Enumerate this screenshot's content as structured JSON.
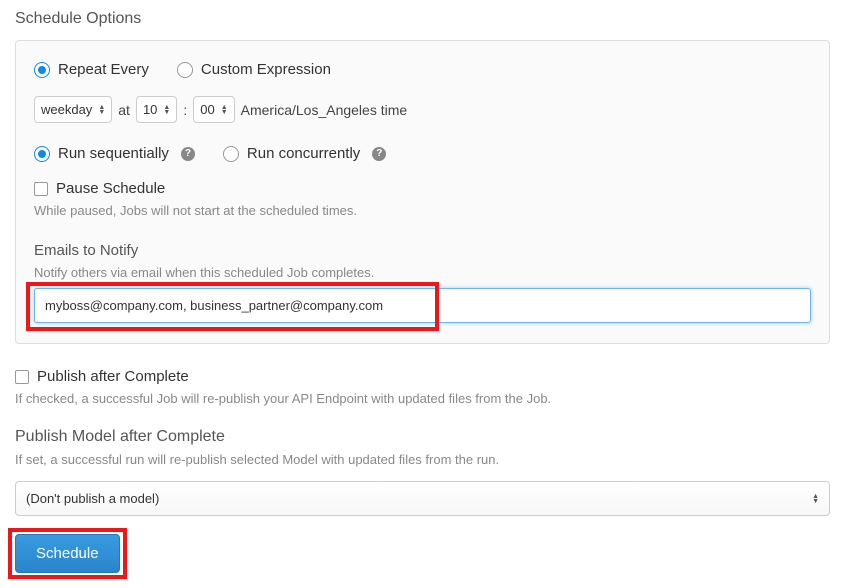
{
  "section_title": "Schedule Options",
  "repeat": {
    "repeat_every_label": "Repeat Every",
    "custom_expression_label": "Custom Expression",
    "selected": "repeat_every"
  },
  "time": {
    "weekday_label": "weekday",
    "at_label": "at",
    "hour": "10",
    "minute": "00",
    "tz_label": "America/Los_Angeles time"
  },
  "run_mode": {
    "sequential_label": "Run sequentially",
    "concurrent_label": "Run concurrently",
    "selected": "sequential"
  },
  "pause": {
    "label": "Pause Schedule",
    "hint": "While paused, Jobs will not start at the scheduled times."
  },
  "emails": {
    "title": "Emails to Notify",
    "hint": "Notify others via email when this scheduled Job completes.",
    "value": "myboss@company.com, business_partner@company.com"
  },
  "publish_after": {
    "label": "Publish after Complete",
    "hint": "If checked, a successful Job will re-publish your API Endpoint with updated files from the Job."
  },
  "publish_model": {
    "title": "Publish Model after Complete",
    "hint": "If set, a successful run will re-publish selected Model with updated files from the run.",
    "selected": "(Don't publish a model)"
  },
  "schedule_button": "Schedule"
}
